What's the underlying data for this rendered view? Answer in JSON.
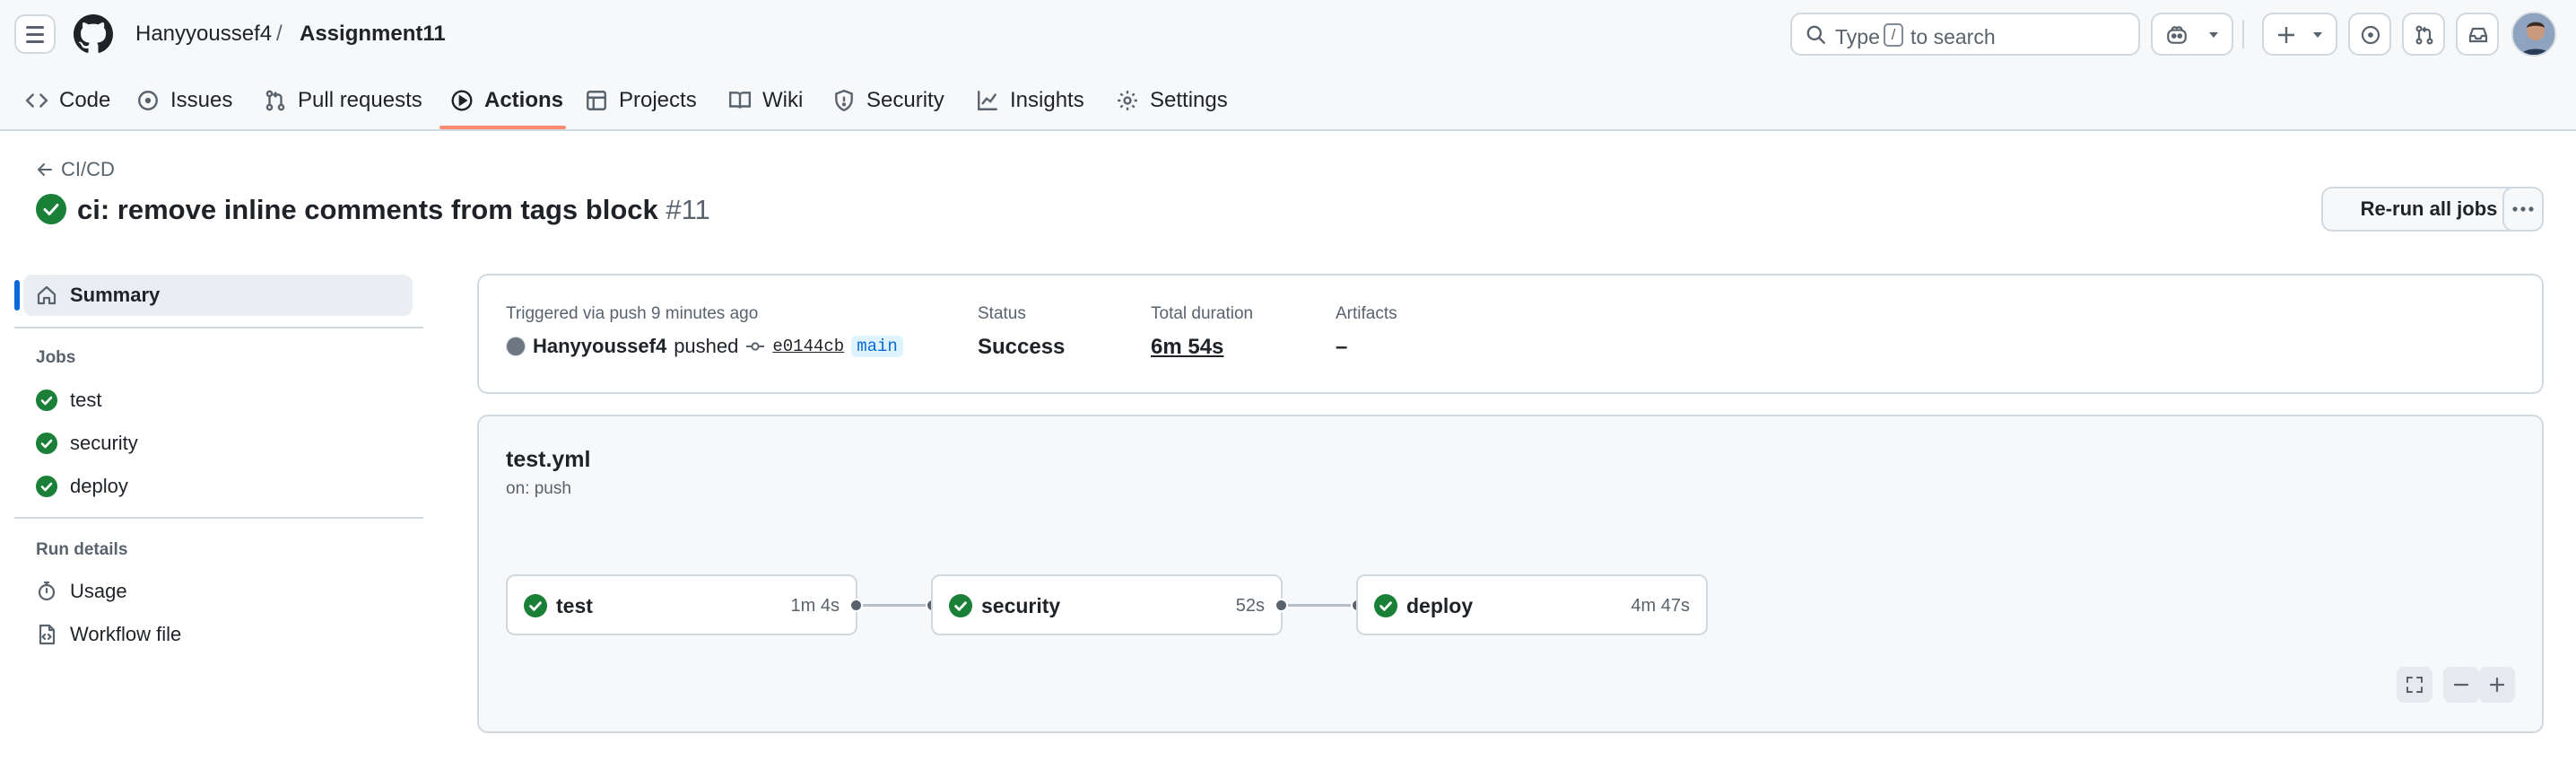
{
  "header": {
    "owner": "Hanyyoussef4",
    "slash": "/",
    "repo": "Assignment11",
    "search_prefix": "Type",
    "search_key": "/",
    "search_suffix": "to search"
  },
  "tabs": [
    {
      "label": "Code",
      "icon": "code-icon"
    },
    {
      "label": "Issues",
      "icon": "issue-icon"
    },
    {
      "label": "Pull requests",
      "icon": "pull-request-icon"
    },
    {
      "label": "Actions",
      "icon": "play-icon",
      "active": true
    },
    {
      "label": "Projects",
      "icon": "table-icon"
    },
    {
      "label": "Wiki",
      "icon": "book-icon"
    },
    {
      "label": "Security",
      "icon": "shield-icon"
    },
    {
      "label": "Insights",
      "icon": "graph-icon"
    },
    {
      "label": "Settings",
      "icon": "gear-icon"
    }
  ],
  "run": {
    "back_label": "CI/CD",
    "title": "ci: remove inline comments from tags block",
    "number": "#11",
    "rerun_label": "Re-run all jobs"
  },
  "sidebar": {
    "summary_label": "Summary",
    "jobs_heading": "Jobs",
    "jobs": [
      "test",
      "security",
      "deploy"
    ],
    "run_details_heading": "Run details",
    "usage_label": "Usage",
    "workflow_file_label": "Workflow file"
  },
  "summary": {
    "trigger_text": "Triggered via push 9 minutes ago",
    "user": "Hanyyoussef4",
    "action": "pushed",
    "commit": "e0144cb",
    "branch": "main",
    "status_label": "Status",
    "status_value": "Success",
    "duration_label": "Total duration",
    "duration_value": "6m 54s",
    "artifacts_label": "Artifacts",
    "artifacts_value": "–"
  },
  "workflow": {
    "file": "test.yml",
    "trigger": "on: push",
    "jobs": [
      {
        "name": "test",
        "duration": "1m 4s",
        "status": "success"
      },
      {
        "name": "security",
        "duration": "52s",
        "status": "success"
      },
      {
        "name": "deploy",
        "duration": "4m 47s",
        "status": "success"
      }
    ]
  },
  "colors": {
    "success": "#1a7f37",
    "accent": "#fd8c73",
    "link": "#0969da"
  }
}
